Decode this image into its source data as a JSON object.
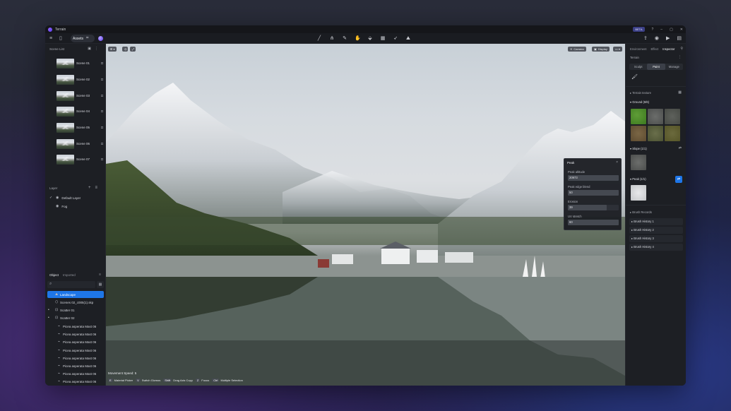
{
  "app": {
    "title": "Terrain",
    "badge": "BETA"
  },
  "toolbar": {
    "assets_label": "Assets"
  },
  "viewport_controls": {
    "camera": "Camera",
    "display": "Display"
  },
  "scene_list": {
    "header": "Scene List",
    "scenes": [
      "Scene 01",
      "Scene 02",
      "Scene 03",
      "Scene 04",
      "Scene 05",
      "Scene 06",
      "Scene 07"
    ]
  },
  "layer": {
    "header": "Layer",
    "items": [
      {
        "label": "Default Layer",
        "checked": true
      },
      {
        "label": "Fog",
        "checked": false
      }
    ]
  },
  "objects": {
    "tabs": [
      "Object",
      "Imported"
    ],
    "rows": [
      {
        "label": "Landscape",
        "selected": true
      },
      {
        "label": "Scenes 02_c005(1).skp"
      },
      {
        "label": "Scatter 01"
      },
      {
        "label": "Scatter 02"
      },
      {
        "label": "Picea asperata Mast 06"
      },
      {
        "label": "Picea asperata Mast 06"
      },
      {
        "label": "Picea asperata Mast 06"
      },
      {
        "label": "Picea asperata Mast 06"
      },
      {
        "label": "Picea asperata Mast 06"
      },
      {
        "label": "Picea asperata Mast 06"
      },
      {
        "label": "Picea asperata Mast 06"
      },
      {
        "label": "Picea asperata Mast 06"
      },
      {
        "label": "Picea asperata Mast 06"
      },
      {
        "label": "Picea asperata Mast 06"
      }
    ]
  },
  "status": {
    "movement": "Movement Speed: 5",
    "shortcuts": [
      {
        "key": "E",
        "label": "Material Picker"
      },
      {
        "key": "V",
        "label": "Switch Gizmos"
      },
      {
        "key": "Shift",
        "label": "Drag Axis Copy"
      },
      {
        "key": "Z",
        "label": "Focus"
      },
      {
        "key": "Ctrl",
        "label": "Multiple Selection"
      }
    ]
  },
  "peak_panel": {
    "title": "Peak",
    "fields": [
      {
        "label": "Peak altitude",
        "value": "20973",
        "fill": 1.0
      },
      {
        "label": "Peak edge blend",
        "value": "50",
        "fill": 1.0
      },
      {
        "label": "Erosion",
        "value": "39",
        "fill": 0.76
      },
      {
        "label": "UV stretch",
        "value": "60",
        "fill": 1.0
      }
    ]
  },
  "inspector": {
    "tabs": [
      "Environment",
      "Effect",
      "Inspector"
    ],
    "active_tab": "Inspector",
    "section": "Terrain",
    "modes": [
      "Sculpt",
      "Paint",
      "Manage"
    ],
    "active_mode": "Paint",
    "texture_header": "Terrain texture",
    "ground": "Ground (6/6)",
    "slope": "Slope (1/1)",
    "peak": "Peak (1/1)",
    "brush_records": "Brush Records",
    "history": [
      "Brush History 1",
      "Brush History 2",
      "Brush History 3",
      "Brush History 4"
    ]
  }
}
